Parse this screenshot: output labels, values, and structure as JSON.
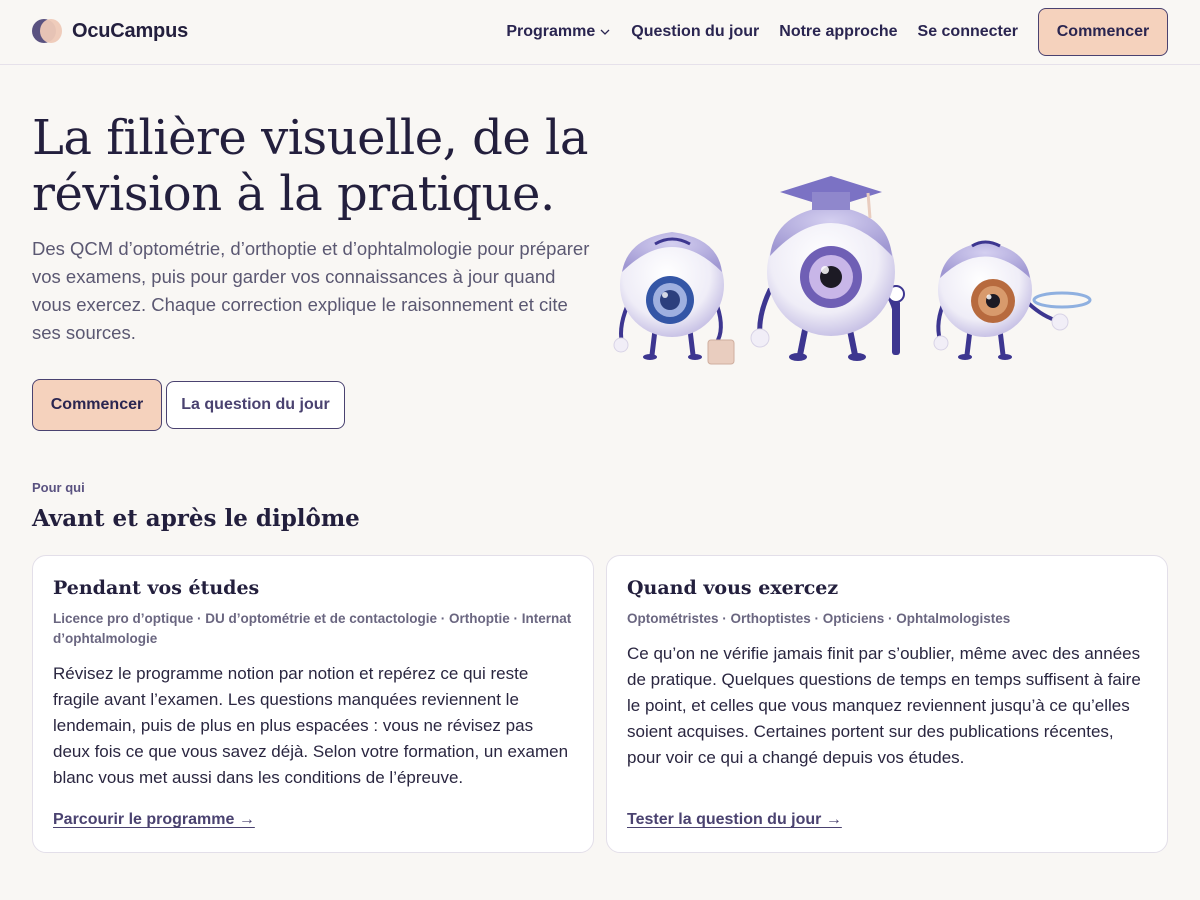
{
  "header": {
    "brand": "OcuCampus",
    "nav": {
      "programme": "Programme",
      "question_du_jour": "Question du jour",
      "notre_approche": "Notre approche",
      "se_connecter": "Se connecter",
      "cta": "Commencer"
    }
  },
  "hero": {
    "title": "La filière visuelle, de la révision à la pratique.",
    "subtitle": "Des QCM d’optométrie, d’orthoptie et d’ophtalmologie pour préparer vos examens, puis pour garder vos connaissances à jour quand vous exercez. Chaque correction explique le raisonnement et cite ses sources.",
    "primary_button": "Commencer",
    "secondary_button": "La question du jour"
  },
  "audience": {
    "eyebrow": "Pour qui",
    "title": "Avant et après le diplôme",
    "cards": [
      {
        "title": "Pendant vos études",
        "meta": "Licence pro d’optique · DU d’optométrie et de contactologie · Orthoptie · Internat d’ophtalmologie",
        "body": "Révisez le programme notion par notion et repérez ce qui reste fragile avant l’examen. Les questions manquées reviennent le lendemain, puis de plus en plus espacées : vous ne révisez pas deux fois ce que vous savez déjà. Selon votre formation, un examen blanc vous met aussi dans les conditions de l’épreuve.",
        "link": "Parcourir le programme →"
      },
      {
        "title": "Quand vous exercez",
        "meta": "Optométristes · Orthoptistes · Opticiens · Ophtalmologistes",
        "body": "Ce qu’on ne vérifie jamais finit par s’oublier, même avec des années de pratique. Quelques questions de temps en temps suffisent à faire le point, et celles que vous manquez reviennent jusqu’à ce qu’elles soient acquises. Certaines portent sur des publications récentes, pour voir ce qui a changé depuis vos études.",
        "link": "Tester la question du jour →"
      }
    ]
  },
  "colors": {
    "accent": "#4a4270",
    "cta_bg": "#f5d2bd",
    "background": "#f9f7f4"
  },
  "icons": {
    "logo": "overlapping-circles-logo-icon",
    "dropdown": "chevron-down-icon",
    "illustration": "cartoon-eyeball-mascots"
  }
}
